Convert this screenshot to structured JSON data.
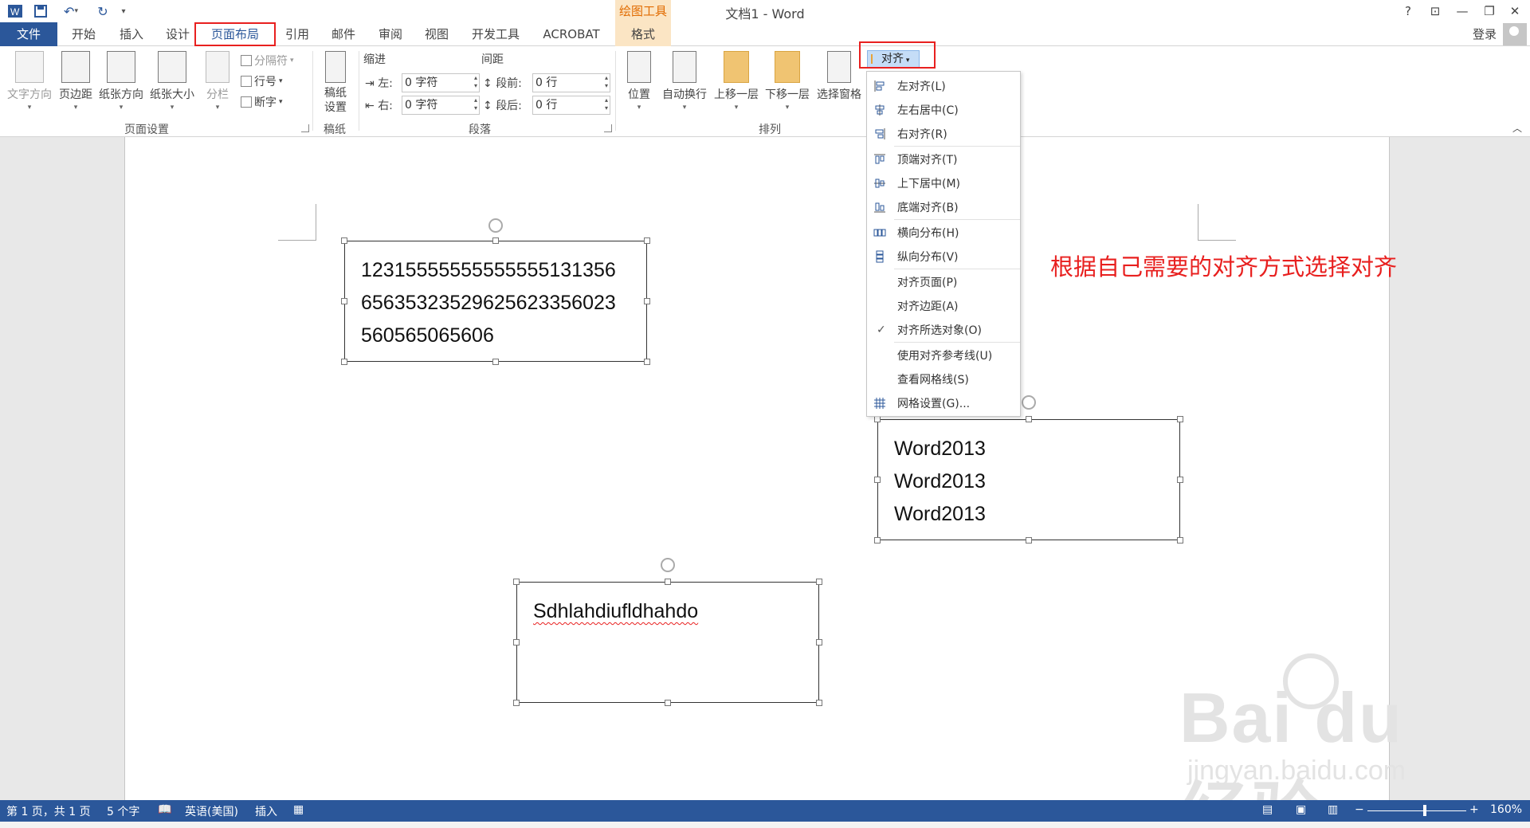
{
  "window": {
    "title": "文档1 - Word",
    "contextual_tab_group": "绘图工具",
    "help_icon": "?",
    "login": "登录"
  },
  "tabs": [
    "文件",
    "开始",
    "插入",
    "设计",
    "页面布局",
    "引用",
    "邮件",
    "审阅",
    "视图",
    "开发工具",
    "ACROBAT",
    "格式"
  ],
  "ribbon": {
    "page_setup": {
      "text_direction": "文字方向",
      "margins": "页边距",
      "orientation": "纸张方向",
      "size": "纸张大小",
      "columns": "分栏",
      "breaks": "分隔符",
      "line_numbers": "行号",
      "hyphenation": "断字",
      "group_label": "页面设置"
    },
    "draft": {
      "settings": "稿纸设置",
      "group_label": "稿纸"
    },
    "paragraph": {
      "indent_label": "缩进",
      "spacing_label": "间距",
      "left_label": "左:",
      "right_label": "右:",
      "left_value": "0 字符",
      "right_value": "0 字符",
      "before_label": "段前:",
      "after_label": "段后:",
      "before_value": "0 行",
      "after_value": "0 行",
      "group_label": "段落"
    },
    "arrange": {
      "position": "位置",
      "wrap_text": "自动换行",
      "bring_forward": "上移一层",
      "send_backward": "下移一层",
      "selection_pane": "选择窗格",
      "align": "对齐",
      "group_label": "排列"
    }
  },
  "align_menu": [
    {
      "label": "左对齐(L)",
      "icon": "align-left-icon",
      "checked": false
    },
    {
      "label": "左右居中(C)",
      "icon": "align-center-icon",
      "checked": false
    },
    {
      "label": "右对齐(R)",
      "icon": "align-right-icon",
      "checked": false
    },
    {
      "label": "顶端对齐(T)",
      "icon": "align-top-icon",
      "checked": false
    },
    {
      "label": "上下居中(M)",
      "icon": "align-middle-icon",
      "checked": false
    },
    {
      "label": "底端对齐(B)",
      "icon": "align-bottom-icon",
      "checked": false
    },
    {
      "label": "横向分布(H)",
      "icon": "distribute-horizontal-icon",
      "checked": false
    },
    {
      "label": "纵向分布(V)",
      "icon": "distribute-vertical-icon",
      "checked": false
    },
    {
      "label": "对齐页面(P)",
      "icon": "",
      "checked": false
    },
    {
      "label": "对齐边距(A)",
      "icon": "",
      "checked": false
    },
    {
      "label": "对齐所选对象(O)",
      "icon": "",
      "checked": true
    },
    {
      "label": "使用对齐参考线(U)",
      "icon": "",
      "checked": false
    },
    {
      "label": "查看网格线(S)",
      "icon": "",
      "checked": false
    },
    {
      "label": "网格设置(G)...",
      "icon": "grid-icon",
      "checked": false
    }
  ],
  "document": {
    "textbox1": [
      "12315555555555555131356",
      "65635323529625623356023",
      "560565065606"
    ],
    "textbox2": [
      "Word2013",
      "Word2013",
      "Word2013"
    ],
    "textbox3": [
      "Sdhlahdiufldhahdo"
    ],
    "annotation": "根据自己需要的对齐方式选择对齐"
  },
  "watermark": {
    "main": "Bai du 经验",
    "sub": "jingyan.baidu.com"
  },
  "statusbar": {
    "page": "第 1 页，共 1 页",
    "words": "5 个字",
    "language": "英语(美国)",
    "mode": "插入",
    "zoom": "160%"
  },
  "colors": {
    "accent": "#2b579a",
    "highlight_red": "#e8201f",
    "contextual": "#fbe5c4"
  }
}
